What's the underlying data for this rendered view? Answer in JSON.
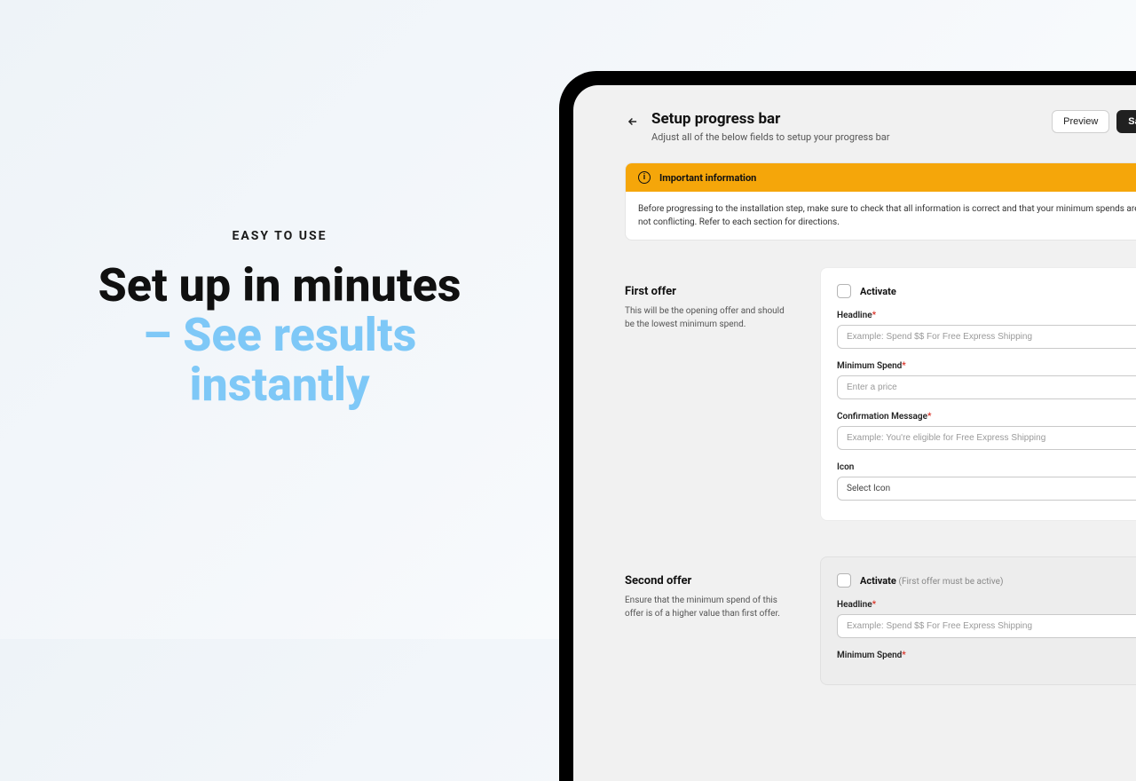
{
  "marketing": {
    "eyebrow": "EASY TO USE",
    "headline_line1": "Set up in minutes",
    "headline_line2a": "– See results",
    "headline_line2b": "instantly"
  },
  "header": {
    "title": "Setup progress bar",
    "subtitle": "Adjust all of the below fields to setup your progress bar",
    "preview_label": "Preview",
    "save_label": "Save"
  },
  "banner": {
    "title": "Important information",
    "body": "Before progressing to the installation step, make sure to check that all information is correct and that your minimum spends are not conflicting. Refer to each section for directions."
  },
  "offers": {
    "first": {
      "title": "First offer",
      "desc": "This will be the opening offer and should be the lowest minimum spend.",
      "activate_label": "Activate",
      "fields": {
        "headline_label": "Headline",
        "headline_placeholder": "Example: Spend $$ For Free Express Shipping",
        "min_spend_label": "Minimum Spend",
        "min_spend_placeholder": "Enter a price",
        "confirm_label": "Confirmation Message",
        "confirm_placeholder": "Example: You're eligible for Free Express Shipping",
        "icon_label": "Icon",
        "icon_value": "Select Icon"
      }
    },
    "second": {
      "title": "Second offer",
      "desc": "Ensure that the minimum spend of this offer is of a higher value than first offer.",
      "activate_label": "Activate",
      "activate_hint": "(First offer must be active)",
      "fields": {
        "headline_label": "Headline",
        "headline_placeholder": "Example: Spend $$ For Free Express Shipping",
        "min_spend_label": "Minimum Spend"
      }
    }
  }
}
